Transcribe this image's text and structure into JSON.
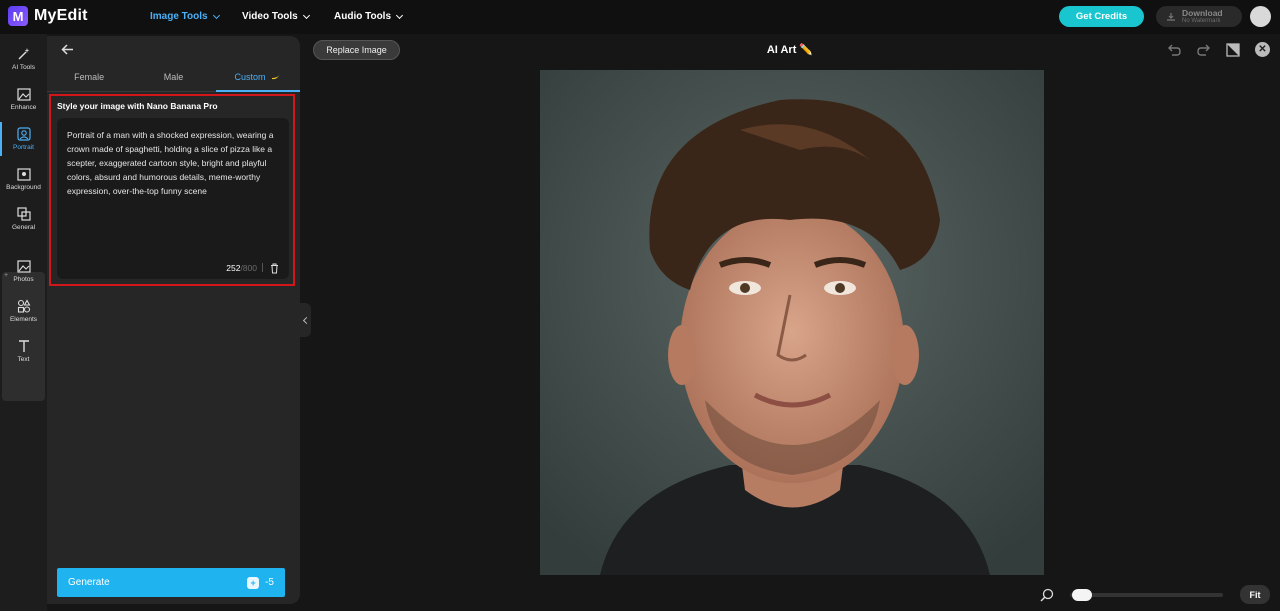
{
  "app": {
    "logo_letter": "M",
    "name": "MyEdit"
  },
  "nav": {
    "image_tools": "Image Tools",
    "video_tools": "Video Tools",
    "audio_tools": "Audio Tools"
  },
  "header": {
    "get_credits": "Get Credits",
    "download": "Download",
    "download_sub": "No Watermark"
  },
  "rail": {
    "items": [
      "AI Tools",
      "Enhance",
      "Portrait",
      "Background",
      "General",
      "Photos",
      "Elements",
      "Text"
    ],
    "active": "Portrait",
    "plus": "+"
  },
  "panel": {
    "tabs": [
      "Female",
      "Male",
      "Custom"
    ],
    "active_tab": "Custom",
    "section_title": "Style your image with Nano Banana Pro",
    "prompt": "Portrait of a man with a shocked expression, wearing a crown made of spaghetti, holding a slice of pizza like a scepter, exaggerated cartoon style, bright and playful colors, absurd and humorous details, meme-worthy expression, over-the-top funny scene",
    "char_count": "252",
    "char_max": "/800",
    "generate_label": "Generate",
    "generate_cost": "-5"
  },
  "canvas": {
    "replace_image": "Replace Image",
    "title": "AI Art ✏️",
    "fit_label": "Fit",
    "zoom_level": 0.02
  },
  "colors": {
    "accent": "#4bb0f5",
    "credits": "#19c6cf",
    "generate": "#1fb3ef",
    "highlight_box": "#d1171b"
  }
}
